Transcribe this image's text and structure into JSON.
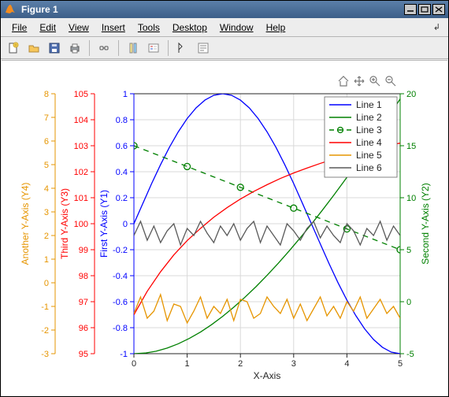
{
  "window": {
    "title": "Figure 1"
  },
  "menu": {
    "file": "File",
    "edit": "Edit",
    "view": "View",
    "insert": "Insert",
    "tools": "Tools",
    "desktop": "Desktop",
    "window": "Window",
    "help": "Help"
  },
  "toolbar": {
    "new": "new",
    "open": "open",
    "save": "save",
    "print": "print",
    "link": "link",
    "cm1": "colormap",
    "cm2": "legend",
    "cursor": "cursor",
    "insert": "insert-text"
  },
  "charticons": {
    "home": "home",
    "pan": "pan",
    "zoomin": "zoom-in",
    "zoomout": "zoom-out"
  },
  "colors": {
    "y1": "#0000ff",
    "y2": "#008000",
    "y3": "#ff0000",
    "y4": "#e69500",
    "l5": "#e69500",
    "l6": "#5a5a5a",
    "grid": "#d9d9d9",
    "axis": "#262626"
  },
  "axes": {
    "x": {
      "label": "X-Axis",
      "ticks": [
        0,
        1,
        2,
        3,
        4,
        5
      ]
    },
    "y1": {
      "label": "First Y-Axis (Y1)",
      "ticks": [
        -1,
        -0.8,
        -0.6,
        -0.4,
        -0.2,
        0,
        0.2,
        0.4,
        0.6,
        0.8,
        1
      ]
    },
    "y2": {
      "label": "Second Y-Axis (Y2)",
      "ticks": [
        -5,
        0,
        5,
        10,
        15,
        20
      ]
    },
    "y3": {
      "label": "Third Y-Axis (Y3)",
      "ticks": [
        95,
        96,
        97,
        98,
        99,
        100,
        101,
        102,
        103,
        104,
        105
      ]
    },
    "y4": {
      "label": "Another Y-Axis (Y4)",
      "ticks": [
        -3,
        -2,
        -1,
        0,
        1,
        2,
        3,
        4,
        5,
        6,
        7,
        8
      ]
    }
  },
  "legend": {
    "items": [
      "Line 1",
      "Line 2",
      "Line 3",
      "Line 4",
      "Line 5",
      "Line 6"
    ]
  },
  "chart_data": {
    "type": "line",
    "title": "",
    "xlabel": "X-Axis",
    "x": [
      0,
      0.25,
      0.5,
      0.75,
      1,
      1.25,
      1.5,
      1.75,
      2,
      2.25,
      2.5,
      2.75,
      3,
      3.25,
      3.5,
      3.75,
      4,
      4.25,
      4.5,
      4.75,
      5
    ],
    "series": [
      {
        "name": "Line 1",
        "axis": "y1",
        "color": "#0000ff",
        "style": "solid",
        "values": [
          0,
          0.155,
          0.309,
          0.454,
          0.588,
          0.707,
          0.809,
          0.891,
          0.951,
          0.988,
          1,
          0.988,
          0.951,
          0.891,
          0.809,
          0.707,
          0.588,
          0.454,
          0.309,
          0.155,
          0,
          -0.155,
          -0.309,
          -0.454,
          -0.588,
          -0.707,
          -0.809,
          -0.891,
          -0.951,
          -0.988,
          -1
        ],
        "x": [
          0,
          0.167,
          0.333,
          0.5,
          0.667,
          0.833,
          1,
          1.167,
          1.333,
          1.5,
          1.667,
          1.833,
          2,
          2.167,
          2.333,
          2.5,
          2.667,
          2.833,
          3,
          3.167,
          3.333,
          3.5,
          3.667,
          3.833,
          4,
          4.167,
          4.333,
          4.5,
          4.667,
          4.833,
          5
        ]
      },
      {
        "name": "Line 2",
        "axis": "y2",
        "color": "#008000",
        "style": "solid",
        "values": [
          -5,
          -4.94,
          -4.76,
          -4.46,
          -4.05,
          -3.53,
          -2.92,
          -2.21,
          -1.41,
          -0.53,
          0.42,
          1.44,
          2.53,
          3.68,
          4.89,
          6.15,
          7.46,
          8.82,
          10.22,
          11.67,
          13.16,
          14.69,
          16.26,
          17.86,
          19.5
        ],
        "x": [
          0,
          0.208,
          0.417,
          0.625,
          0.833,
          1.042,
          1.25,
          1.458,
          1.667,
          1.875,
          2.083,
          2.292,
          2.5,
          2.708,
          2.917,
          3.125,
          3.333,
          3.542,
          3.75,
          3.958,
          4.167,
          4.375,
          4.583,
          4.792,
          5
        ]
      },
      {
        "name": "Line 3",
        "axis": "y2",
        "color": "#008000",
        "style": "dashed-marker",
        "values": [
          15,
          13,
          11,
          9,
          7,
          5
        ],
        "x": [
          0,
          1,
          2,
          3,
          4,
          5
        ]
      },
      {
        "name": "Line 4",
        "axis": "y3",
        "color": "#ff0000",
        "style": "solid",
        "values": [
          96.5,
          97.4,
          98.15,
          98.8,
          99.35,
          99.82,
          100.25,
          100.62,
          100.95,
          101.24,
          101.5,
          101.74,
          101.95,
          102.14,
          102.32,
          102.48,
          102.62,
          102.76,
          102.88,
          103,
          103.1
        ],
        "x": [
          0,
          0.25,
          0.5,
          0.75,
          1,
          1.25,
          1.5,
          1.75,
          2,
          2.25,
          2.5,
          2.75,
          3,
          3.25,
          3.5,
          3.75,
          4,
          4.25,
          4.5,
          4.75,
          5
        ]
      },
      {
        "name": "Line 5",
        "axis": "y4",
        "color": "#e69500",
        "style": "solid",
        "values": [
          -1.3,
          -0.6,
          -1.5,
          -1.2,
          -0.5,
          -1.6,
          -0.9,
          -1.0,
          -1.7,
          -1.2,
          -0.6,
          -1.5,
          -1.0,
          -1.3,
          -0.7,
          -1.6,
          -0.7,
          -0.8,
          -1.5,
          -1.3,
          -0.6,
          -1.0,
          -1.3,
          -0.7,
          -1.5,
          -0.9,
          -1.6,
          -1.1,
          -0.6,
          -1.4,
          -1.0,
          -1.5,
          -0.8,
          -1.2,
          -0.6,
          -1.5,
          -1.1,
          -0.7,
          -1.3,
          -1.0,
          -1.5
        ],
        "x": [
          0,
          0.125,
          0.25,
          0.375,
          0.5,
          0.625,
          0.75,
          0.875,
          1,
          1.125,
          1.25,
          1.375,
          1.5,
          1.625,
          1.75,
          1.875,
          2,
          2.125,
          2.25,
          2.375,
          2.5,
          2.625,
          2.75,
          2.875,
          3,
          3.125,
          3.25,
          3.375,
          3.5,
          3.625,
          3.75,
          3.875,
          4,
          4.125,
          4.25,
          4.375,
          4.5,
          4.625,
          4.75,
          4.875,
          5
        ]
      },
      {
        "name": "Line 6",
        "axis": "y4",
        "color": "#5a5a5a",
        "style": "solid",
        "values": [
          2.0,
          2.6,
          1.8,
          2.4,
          1.7,
          2.2,
          2.5,
          1.6,
          2.3,
          2.0,
          2.6,
          2.1,
          1.7,
          2.4,
          2.0,
          2.5,
          1.8,
          2.3,
          2.6,
          1.7,
          2.4,
          2.0,
          1.6,
          2.5,
          2.2,
          1.8,
          2.3,
          2.6,
          1.9,
          2.4,
          2.0,
          1.7,
          2.5,
          2.2,
          1.6,
          2.3,
          2.0,
          2.6,
          1.8,
          2.4,
          2.0
        ],
        "x": [
          0,
          0.125,
          0.25,
          0.375,
          0.5,
          0.625,
          0.75,
          0.875,
          1,
          1.125,
          1.25,
          1.375,
          1.5,
          1.625,
          1.75,
          1.875,
          2,
          2.125,
          2.25,
          2.375,
          2.5,
          2.625,
          2.75,
          2.875,
          3,
          3.125,
          3.25,
          3.375,
          3.5,
          3.625,
          3.75,
          3.875,
          4,
          4.125,
          4.25,
          4.375,
          4.5,
          4.625,
          4.75,
          4.875,
          5
        ]
      }
    ],
    "yaxes": {
      "y1": {
        "label": "First Y-Axis (Y1)",
        "range": [
          -1,
          1
        ],
        "color": "#0000ff",
        "side": "left",
        "offset": 0
      },
      "y2": {
        "label": "Second Y-Axis (Y2)",
        "range": [
          -5,
          20
        ],
        "color": "#008000",
        "side": "right",
        "offset": 0
      },
      "y3": {
        "label": "Third Y-Axis (Y3)",
        "range": [
          95,
          105
        ],
        "color": "#ff0000",
        "side": "left",
        "offset": 1
      },
      "y4": {
        "label": "Another Y-Axis (Y4)",
        "range": [
          -3,
          8
        ],
        "color": "#e69500",
        "side": "left",
        "offset": 2
      }
    },
    "xrange": [
      0,
      5
    ]
  }
}
